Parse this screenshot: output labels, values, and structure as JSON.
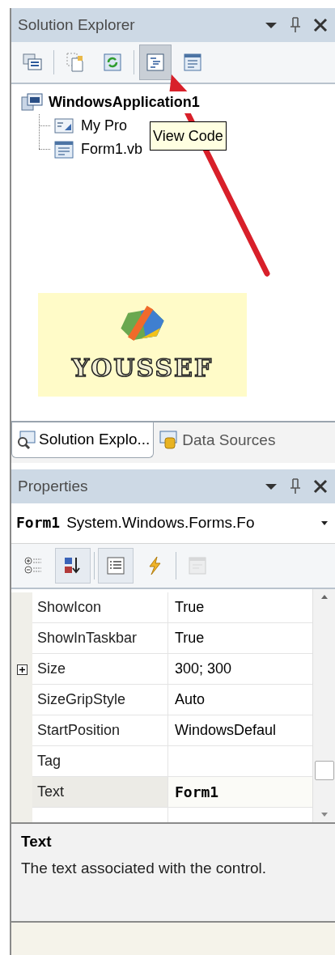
{
  "solution_explorer": {
    "title": "Solution Explorer",
    "toolbar": [
      {
        "kind": "properties",
        "highlighted": false
      },
      {
        "kind": "show-all",
        "highlighted": false
      },
      {
        "kind": "refresh",
        "highlighted": false
      },
      {
        "kind": "view-code",
        "highlighted": true
      },
      {
        "kind": "view-designer",
        "highlighted": false
      }
    ],
    "tooltip": "View Code",
    "tree": [
      {
        "label": "WindowsApplication1",
        "kind": "project",
        "children": [
          {
            "label": "My Pro",
            "kind": "my-project"
          },
          {
            "label": "Form1.vb",
            "kind": "form"
          }
        ]
      }
    ],
    "picture_text": "YOUSSEF",
    "tabs": [
      {
        "label": "Solution Explo...",
        "kind": "explorer",
        "selected": true
      },
      {
        "label": "Data Sources",
        "kind": "data",
        "selected": false
      }
    ]
  },
  "properties": {
    "title": "Properties",
    "object": {
      "name": "Form1",
      "type": "System.Windows.Forms.Fo"
    },
    "toolbar": [
      {
        "kind": "categorized",
        "pressed": false,
        "disabled": false
      },
      {
        "kind": "alphabetical",
        "pressed": true,
        "disabled": false
      },
      {
        "kind": "properties",
        "pressed": true,
        "disabled": false
      },
      {
        "kind": "events",
        "pressed": false,
        "disabled": false
      },
      {
        "kind": "property-pages",
        "pressed": false,
        "disabled": true
      }
    ],
    "rows": [
      {
        "name": "ShowIcon",
        "value": "True",
        "expandable": false,
        "selected": false,
        "modified": false
      },
      {
        "name": "ShowInTaskbar",
        "value": "True",
        "expandable": false,
        "selected": false,
        "modified": false
      },
      {
        "name": "Size",
        "value": "300; 300",
        "expandable": true,
        "selected": false,
        "modified": false
      },
      {
        "name": "SizeGripStyle",
        "value": "Auto",
        "expandable": false,
        "selected": false,
        "modified": false
      },
      {
        "name": "StartPosition",
        "value": "WindowsDefaul",
        "expandable": false,
        "selected": false,
        "modified": false
      },
      {
        "name": "Tag",
        "expandable": false,
        "selected": false
      },
      {
        "name": "Text",
        "value": "Form1",
        "expandable": false,
        "selected": true,
        "modified": true
      }
    ],
    "description": {
      "title": "Text",
      "text": "The text associated with the control."
    }
  }
}
